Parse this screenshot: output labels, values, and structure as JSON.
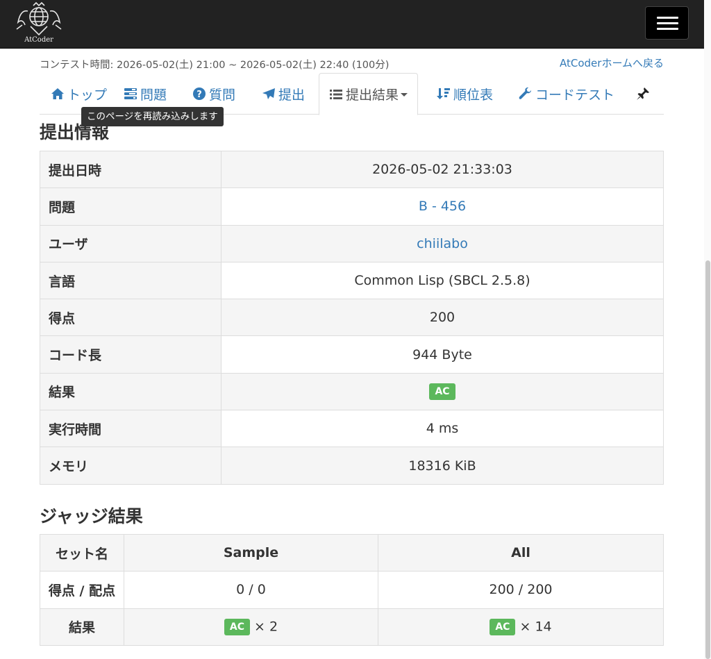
{
  "navbar": {
    "logo_text": "AtCoder"
  },
  "header": {
    "contest_time": "コンテスト時間: 2026-05-02(土) 21:00 ~ 2026-05-02(土) 22:40 (100分)",
    "home_link": "AtCoderホームへ戻る"
  },
  "tabs": [
    {
      "label": "トップ",
      "icon": "home-icon"
    },
    {
      "label": "問題",
      "icon": "tasks-icon"
    },
    {
      "label": "質問",
      "icon": "question-circle-icon"
    },
    {
      "label": "提出",
      "icon": "send-icon"
    },
    {
      "label": "提出結果",
      "icon": "list-icon",
      "active": true
    },
    {
      "label": "順位表",
      "icon": "sort-icon"
    },
    {
      "label": "コードテスト",
      "icon": "wrench-icon"
    }
  ],
  "tooltip": "このページを再読み込みします",
  "submission": {
    "title": "提出情報",
    "rows": [
      {
        "label": "提出日時",
        "value": "2026-05-02 21:33:03"
      },
      {
        "label": "問題",
        "value": "B - 456"
      },
      {
        "label": "ユーザ",
        "value": "chiilabo"
      },
      {
        "label": "言語",
        "value": "Common Lisp (SBCL 2.5.8)"
      },
      {
        "label": "得点",
        "value": "200"
      },
      {
        "label": "コード長",
        "value": "944 Byte"
      },
      {
        "label": "結果",
        "value": "AC"
      },
      {
        "label": "実行時間",
        "value": "4 ms"
      },
      {
        "label": "メモリ",
        "value": "18316 KiB"
      }
    ]
  },
  "judge": {
    "title": "ジャッジ結果",
    "headers": [
      "セット名",
      "Sample",
      "All"
    ],
    "score_label": "得点 / 配点",
    "score_sample": "0 / 0",
    "score_all": "200 / 200",
    "result_label": "結果",
    "result_badge": "AC",
    "result_sample_count": "× 2",
    "result_all_count": "× 14"
  },
  "colors": {
    "link": "#337ab7",
    "ac_badge": "#5cb85c",
    "navbar": "#222222"
  }
}
